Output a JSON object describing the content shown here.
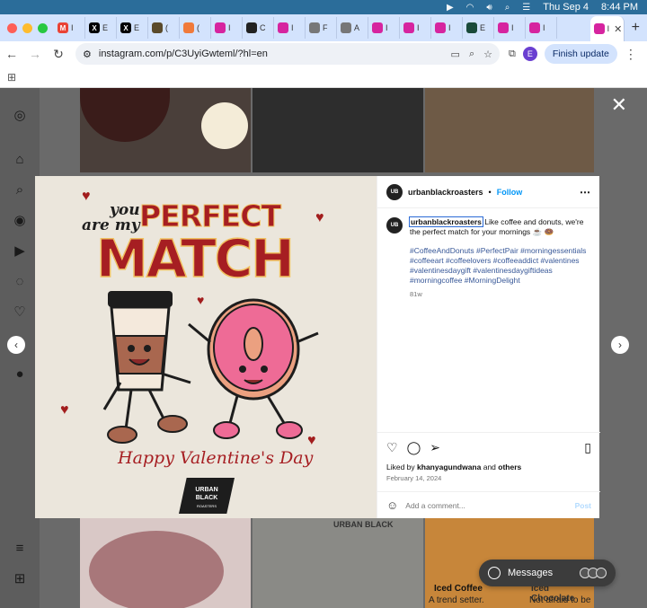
{
  "menubar": {
    "date": "Thu Sep 4",
    "time": "8:44 PM"
  },
  "tabs": [
    {
      "icon": "gmail-icon",
      "letter": "M",
      "color": "#ea4335",
      "label": "I"
    },
    {
      "icon": "x-icon",
      "letter": "X",
      "color": "#000000",
      "label": "E"
    },
    {
      "icon": "x-icon",
      "letter": "X",
      "color": "#000000",
      "label": "E"
    },
    {
      "icon": "site-icon",
      "letter": "",
      "color": "#5a4a2a",
      "label": "("
    },
    {
      "icon": "site-icon",
      "letter": "",
      "color": "#f07a3a",
      "label": "("
    },
    {
      "icon": "instagram-icon",
      "letter": "",
      "color": "#d6249f",
      "label": "I"
    },
    {
      "icon": "site-icon",
      "letter": "",
      "color": "#222222",
      "label": "C"
    },
    {
      "icon": "instagram-icon",
      "letter": "",
      "color": "#d6249f",
      "label": "I"
    },
    {
      "icon": "script-icon",
      "letter": "",
      "color": "#777777",
      "label": "F"
    },
    {
      "icon": "script-icon",
      "letter": "",
      "color": "#777777",
      "label": "A"
    },
    {
      "icon": "instagram-icon",
      "letter": "",
      "color": "#d6249f",
      "label": "I"
    },
    {
      "icon": "instagram-icon",
      "letter": "",
      "color": "#d6249f",
      "label": "I"
    },
    {
      "icon": "instagram-icon",
      "letter": "",
      "color": "#d6249f",
      "label": "I"
    },
    {
      "icon": "site-icon",
      "letter": "",
      "color": "#1a4a3a",
      "label": "E"
    },
    {
      "icon": "instagram-icon",
      "letter": "",
      "color": "#d6249f",
      "label": "I"
    },
    {
      "icon": "instagram-icon",
      "letter": "",
      "color": "#d6249f",
      "label": "I"
    }
  ],
  "active_tab": {
    "label": "I",
    "close": "✕"
  },
  "toolbar": {
    "url": "instagram.com/p/C3UyiGwteml/?hl=en",
    "profile_letter": "E",
    "finish_update": "Finish update"
  },
  "post": {
    "username": "urbanblackroasters",
    "follow": "Follow",
    "separator": "•",
    "avatar_text": "UB",
    "caption": " Like coffee and donuts, we're the perfect match for your mornings ☕ 🍩",
    "hashtags": "#CoffeeAndDonuts #PerfectPair #morningessentials #coffeeart #coffeelovers #coffeeaddict #valentines #valentinesdaygift #valentinesdaygiftideas #morningcoffee #MorningDelight",
    "time_ago": "81w",
    "liked_by_prefix": "Liked by ",
    "liked_by_user": "khanyagundwana",
    "liked_by_and": " and ",
    "liked_by_others": "others",
    "date": "February 14, 2024",
    "comment_placeholder": "Add a comment...",
    "post_button": "Post"
  },
  "artwork": {
    "you_line1": "you",
    "you_line2": "are my",
    "perfect": "PERFECT",
    "match": "MATCH",
    "valentine": "Happy Valentine's Day",
    "brand_line1": "URBAN",
    "brand_line2": "BLACK",
    "brand_line3": "ROASTERS"
  },
  "background_tiles": {
    "tile_left_brand": "URBAN BLACK",
    "tile_right_title": "Iced Coffee",
    "tile_right_sub": "A trend setter.",
    "tile_far_title": "Iced Chocolate",
    "tile_far_sub": "Not afraid to be"
  },
  "messages": {
    "label": "Messages"
  }
}
